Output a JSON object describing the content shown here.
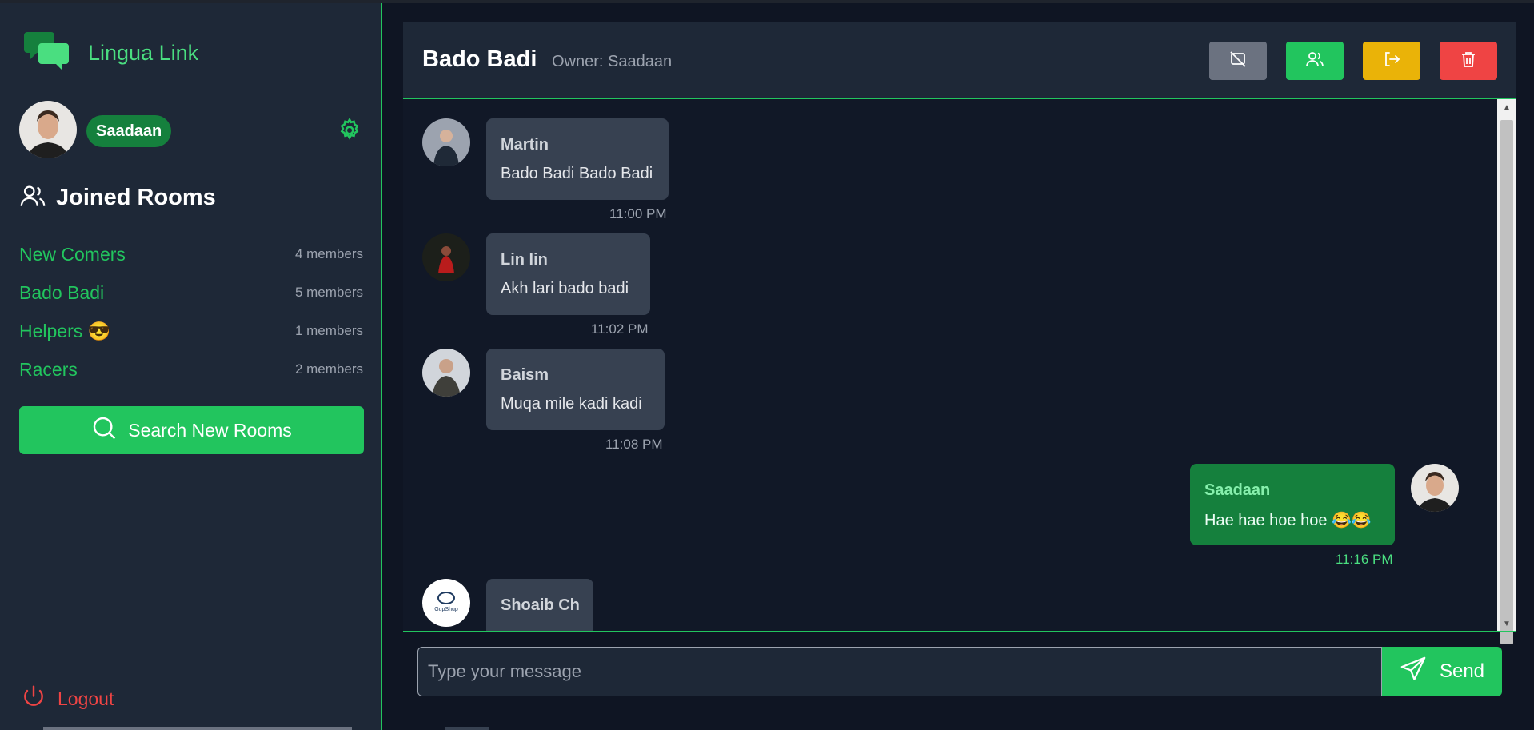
{
  "app": {
    "name": "Lingua Link"
  },
  "user": {
    "name": "Saadaan"
  },
  "sidebar": {
    "joined_title": "Joined Rooms",
    "rooms": [
      {
        "name": "New Comers",
        "members": "4 members"
      },
      {
        "name": "Bado Badi",
        "members": "5 members"
      },
      {
        "name": "Helpers 😎",
        "members": "1 members"
      },
      {
        "name": "Racers",
        "members": "2 members"
      }
    ],
    "search_label": "Search New Rooms",
    "logout_label": "Logout"
  },
  "room": {
    "title": "Bado Badi",
    "owner": "Owner: Saadaan"
  },
  "header_buttons": [
    "video-off-icon",
    "members-icon",
    "leave-icon",
    "trash-icon"
  ],
  "messages": [
    {
      "sender": "Martin",
      "text": "Bado Badi Bado Badi",
      "time": "11:00 PM",
      "own": false
    },
    {
      "sender": "Lin lin",
      "text": "Akh lari bado badi",
      "time": "11:02 PM",
      "own": false
    },
    {
      "sender": "Baism",
      "text": "Muqa mile kadi kadi",
      "time": "11:08 PM",
      "own": false
    },
    {
      "sender": "Saadaan",
      "text": "Hae hae hoe hoe 😂😂",
      "time": "11:16 PM",
      "own": true
    },
    {
      "sender": "Shoaib Ch",
      "text": "",
      "time": "",
      "own": false
    }
  ],
  "composer": {
    "placeholder": "Type your message",
    "send_label": "Send"
  },
  "colors": {
    "accent": "#22c55e",
    "sidebar_bg": "#1e2837",
    "chat_bg": "#111827",
    "own_bubble": "#15803d",
    "bubble": "#374151",
    "danger": "#ef4444",
    "warning": "#eab308"
  }
}
